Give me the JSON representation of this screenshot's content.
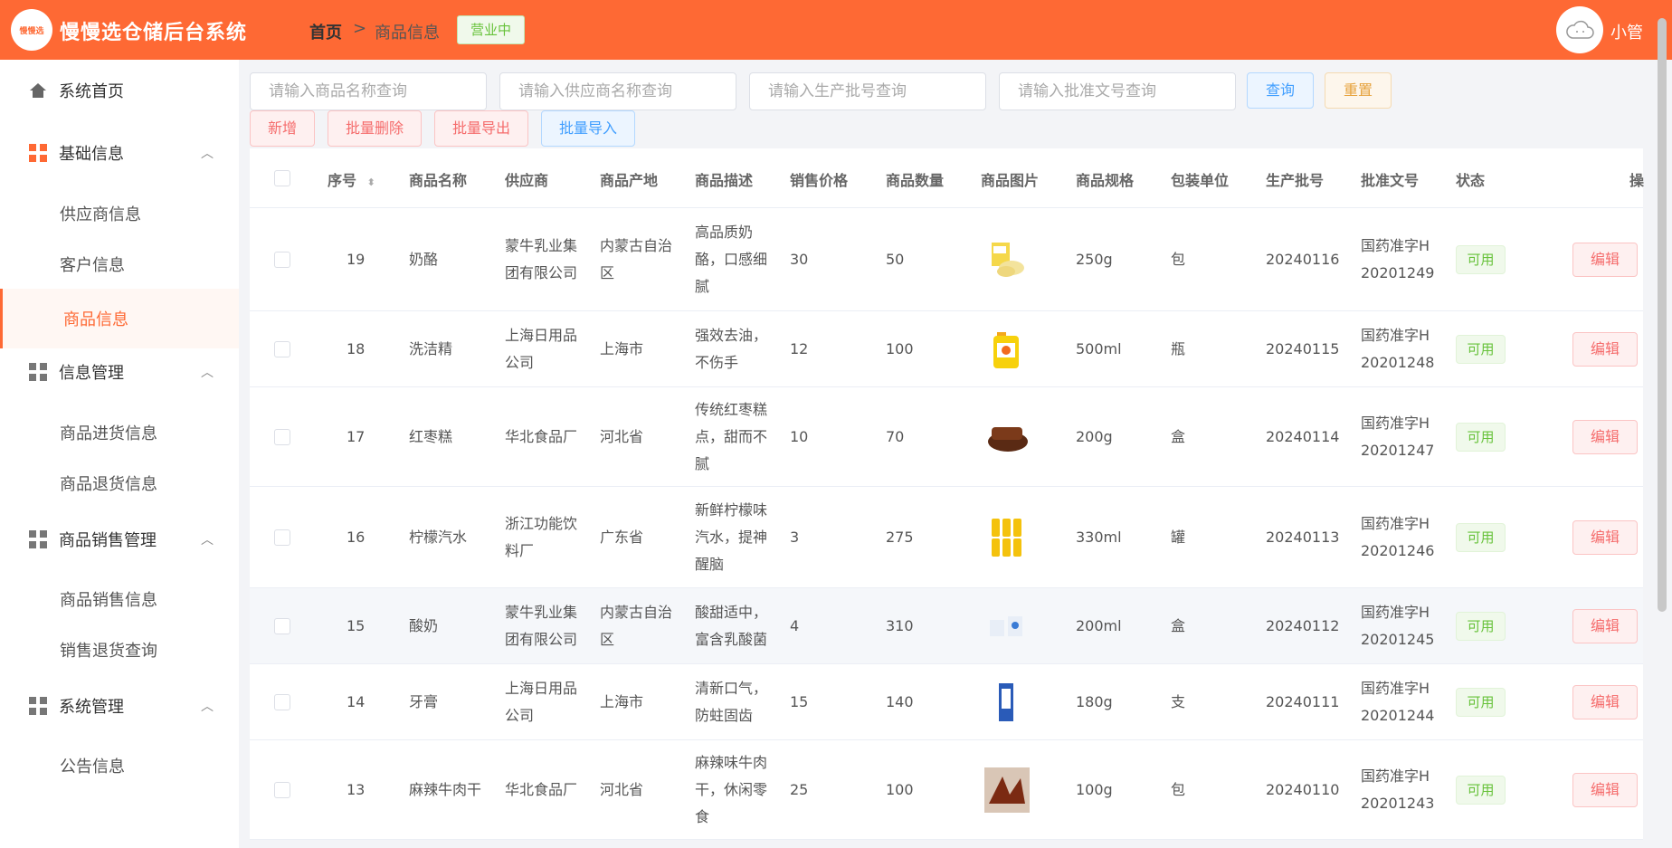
{
  "header": {
    "logo_text": "慢慢选",
    "app_title": "慢慢选仓储后台系统",
    "breadcrumb_home": "首页",
    "breadcrumb_sep": ">",
    "breadcrumb_current": "商品信息",
    "open_status": "营业中",
    "username": "小管"
  },
  "sidebar": {
    "home": "系统首页",
    "basic_info": "基础信息",
    "supplier_info": "供应商信息",
    "customer_info": "客户信息",
    "product_info": "商品信息",
    "info_mgmt": "信息管理",
    "purchase_info": "商品进货信息",
    "return_info": "商品退货信息",
    "sales_mgmt": "商品销售管理",
    "sales_info": "商品销售信息",
    "sales_return_query": "销售退货查询",
    "system_mgmt": "系统管理",
    "notice_info": "公告信息"
  },
  "search": {
    "name_placeholder": "请输入商品名称查询",
    "supplier_placeholder": "请输入供应商名称查询",
    "batch_placeholder": "请输入生产批号查询",
    "approval_placeholder": "请输入批准文号查询",
    "query_label": "查询",
    "reset_label": "重置"
  },
  "actions": {
    "add": "新增",
    "batch_delete": "批量删除",
    "batch_export": "批量导出",
    "batch_import": "批量导入"
  },
  "table": {
    "headers": {
      "seq": "序号",
      "name": "商品名称",
      "supplier": "供应商",
      "origin": "商品产地",
      "desc": "商品描述",
      "price": "销售价格",
      "qty": "商品数量",
      "image": "商品图片",
      "spec": "商品规格",
      "unit": "包装单位",
      "batch": "生产批号",
      "approval": "批准文号",
      "status": "状态",
      "op": "操"
    },
    "rows": [
      {
        "seq": "19",
        "name": "奶酪",
        "supplier": [
          "蒙牛乳业集",
          "团有限公司"
        ],
        "origin": [
          "内蒙古自治",
          "区"
        ],
        "desc": [
          "高品质奶",
          "酪，口感细",
          "腻"
        ],
        "price": "30",
        "qty": "50",
        "spec": "250g",
        "unit": "包",
        "batch": "20240116",
        "approval": [
          "国药准字H",
          "20201249"
        ],
        "status": "可用",
        "edit": "编辑"
      },
      {
        "seq": "18",
        "name": "洗洁精",
        "supplier": [
          "上海日用品",
          "公司"
        ],
        "origin": [
          "上海市"
        ],
        "desc": [
          "强效去油，",
          "不伤手"
        ],
        "price": "12",
        "qty": "100",
        "spec": "500ml",
        "unit": "瓶",
        "batch": "20240115",
        "approval": [
          "国药准字H",
          "20201248"
        ],
        "status": "可用",
        "edit": "编辑"
      },
      {
        "seq": "17",
        "name": "红枣糕",
        "supplier": [
          "华北食品厂"
        ],
        "origin": [
          "河北省"
        ],
        "desc": [
          "传统红枣糕",
          "点，甜而不",
          "腻"
        ],
        "price": "10",
        "qty": "70",
        "spec": "200g",
        "unit": "盒",
        "batch": "20240114",
        "approval": [
          "国药准字H",
          "20201247"
        ],
        "status": "可用",
        "edit": "编辑"
      },
      {
        "seq": "16",
        "name": "柠檬汽水",
        "supplier": [
          "浙江功能饮",
          "料厂"
        ],
        "origin": [
          "广东省"
        ],
        "desc": [
          "新鲜柠檬味",
          "汽水，提神",
          "醒脑"
        ],
        "price": "3",
        "qty": "275",
        "spec": "330ml",
        "unit": "罐",
        "batch": "20240113",
        "approval": [
          "国药准字H",
          "20201246"
        ],
        "status": "可用",
        "edit": "编辑"
      },
      {
        "seq": "15",
        "name": "酸奶",
        "supplier": [
          "蒙牛乳业集",
          "团有限公司"
        ],
        "origin": [
          "内蒙古自治",
          "区"
        ],
        "desc": [
          "酸甜适中，",
          "富含乳酸菌"
        ],
        "price": "4",
        "qty": "310",
        "spec": "200ml",
        "unit": "盒",
        "batch": "20240112",
        "approval": [
          "国药准字H",
          "20201245"
        ],
        "status": "可用",
        "edit": "编辑"
      },
      {
        "seq": "14",
        "name": "牙膏",
        "supplier": [
          "上海日用品",
          "公司"
        ],
        "origin": [
          "上海市"
        ],
        "desc": [
          "清新口气，",
          "防蛀固齿"
        ],
        "price": "15",
        "qty": "140",
        "spec": "180g",
        "unit": "支",
        "batch": "20240111",
        "approval": [
          "国药准字H",
          "20201244"
        ],
        "status": "可用",
        "edit": "编辑"
      },
      {
        "seq": "13",
        "name": "麻辣牛肉干",
        "supplier": [
          "华北食品厂"
        ],
        "origin": [
          "河北省"
        ],
        "desc": [
          "麻辣味牛肉",
          "干，休闲零",
          "食"
        ],
        "price": "25",
        "qty": "100",
        "spec": "100g",
        "unit": "包",
        "batch": "20240110",
        "approval": [
          "国药准字H",
          "20201243"
        ],
        "status": "可用",
        "edit": "编辑"
      }
    ]
  },
  "colors": {
    "brand": "#fe6934",
    "status_green": "#67c23a",
    "danger": "#f56c6c",
    "primary": "#409eff",
    "warning": "#e6a23c"
  }
}
